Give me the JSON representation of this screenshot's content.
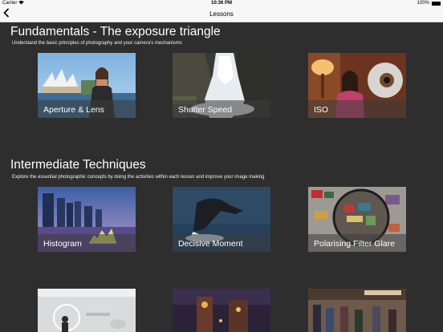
{
  "status_bar": {
    "carrier": "Carrier",
    "time": "10:36 PM",
    "battery": "100%"
  },
  "nav": {
    "title": "Lessons",
    "back_icon": "chevron-left-icon"
  },
  "sections": [
    {
      "title": "Fundamentals - The exposure triangle",
      "subtitle": "Understand the basic principles of photography and your camera's mechanisms",
      "lessons": [
        {
          "label": "Aperture & Lens"
        },
        {
          "label": "Shutter Speed"
        },
        {
          "label": "ISO"
        }
      ]
    },
    {
      "title": "Intermediate Techniques",
      "subtitle": "Explore the essential photographic concepts by doing the activities within each lesson and improve your image making",
      "lessons": [
        {
          "label": "Histogram"
        },
        {
          "label": "Decisive Moment"
        },
        {
          "label": "Polarising Filter Glare"
        }
      ]
    }
  ],
  "colors": {
    "background": "#2e2e2e",
    "bar": "#f7f7f7"
  }
}
